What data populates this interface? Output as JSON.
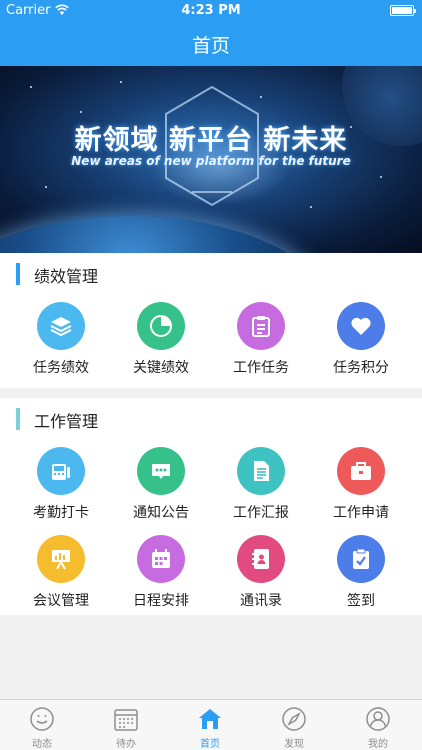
{
  "status_bar": {
    "carrier": "Carrier",
    "time": "4:23 PM"
  },
  "nav": {
    "title": "首页"
  },
  "banner": {
    "headline": "新领域 新平台 新未来",
    "subline": "New areas of new platform for the future"
  },
  "sections": [
    {
      "title": "绩效管理",
      "accent": "#2b9df2",
      "items": [
        {
          "label": "任务绩效",
          "icon": "layers-icon",
          "color": "#4cb8f0"
        },
        {
          "label": "关键绩效",
          "icon": "pie-chart-icon",
          "color": "#36c18a"
        },
        {
          "label": "工作任务",
          "icon": "clipboard-icon",
          "color": "#c76ce0"
        },
        {
          "label": "任务积分",
          "icon": "heart-icon",
          "color": "#4d7de8"
        }
      ]
    },
    {
      "title": "工作管理",
      "accent": "#7ed0d8",
      "items": [
        {
          "label": "考勤打卡",
          "icon": "punch-clock-icon",
          "color": "#4cb8f0"
        },
        {
          "label": "通知公告",
          "icon": "message-icon",
          "color": "#36c18a"
        },
        {
          "label": "工作汇报",
          "icon": "report-icon",
          "color": "#3ec2c2"
        },
        {
          "label": "工作申请",
          "icon": "briefcase-icon",
          "color": "#ee5a5a"
        },
        {
          "label": "会议管理",
          "icon": "presentation-icon",
          "color": "#f5bd2e"
        },
        {
          "label": "日程安排",
          "icon": "calendar-icon",
          "color": "#c76ce0"
        },
        {
          "label": "通讯录",
          "icon": "contacts-icon",
          "color": "#e14b80"
        },
        {
          "label": "签到",
          "icon": "checkin-icon",
          "color": "#4d7de8"
        }
      ]
    }
  ],
  "tabs": [
    {
      "label": "动态",
      "icon": "smile-icon",
      "active": false
    },
    {
      "label": "待办",
      "icon": "calendar-grid-icon",
      "active": false
    },
    {
      "label": "首页",
      "icon": "home-icon",
      "active": true
    },
    {
      "label": "发现",
      "icon": "compass-icon",
      "active": false
    },
    {
      "label": "我的",
      "icon": "user-icon",
      "active": false
    }
  ],
  "colors": {
    "primary": "#2b9df2",
    "inactive_tab": "#8e8e8e",
    "background": "#f1f1f1"
  }
}
